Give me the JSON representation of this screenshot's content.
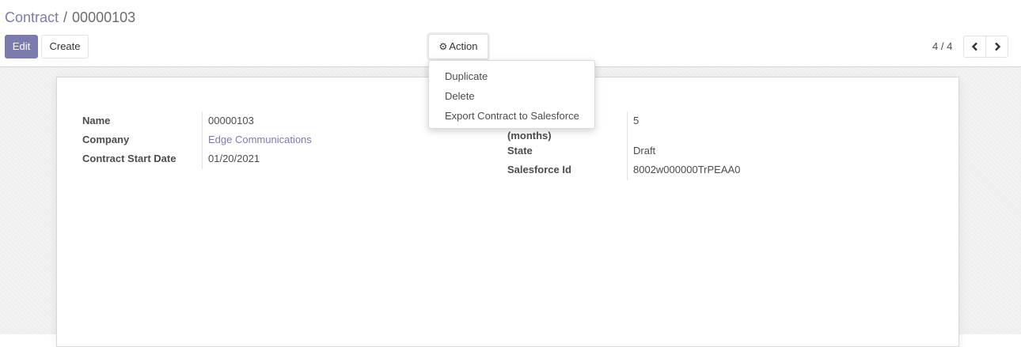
{
  "breadcrumb": {
    "parent": "Contract",
    "separator": "/",
    "current": "00000103"
  },
  "toolbar": {
    "edit_label": "Edit",
    "create_label": "Create",
    "action_label": "Action"
  },
  "pager": {
    "value": "4 / 4"
  },
  "action_menu": {
    "items": [
      "Duplicate",
      "Delete",
      "Export Contract to Salesforce"
    ]
  },
  "form": {
    "left": [
      {
        "label": "Name",
        "value": "00000103"
      },
      {
        "label": "Company",
        "value": "Edge Communications"
      },
      {
        "label": "Contract Start Date",
        "value": "01/20/2021"
      }
    ],
    "right": [
      {
        "label": "(months)",
        "value": "5"
      },
      {
        "label": "State",
        "value": "Draft"
      },
      {
        "label": "Salesforce Id",
        "value": "8002w000000TrPEAA0"
      }
    ]
  },
  "colors": {
    "primary": "#7c7bad",
    "text": "#4c4c4c",
    "border": "#dee2e6"
  },
  "icons": {
    "action": "gear-icon",
    "prev": "chevron-left-icon",
    "next": "chevron-right-icon"
  }
}
